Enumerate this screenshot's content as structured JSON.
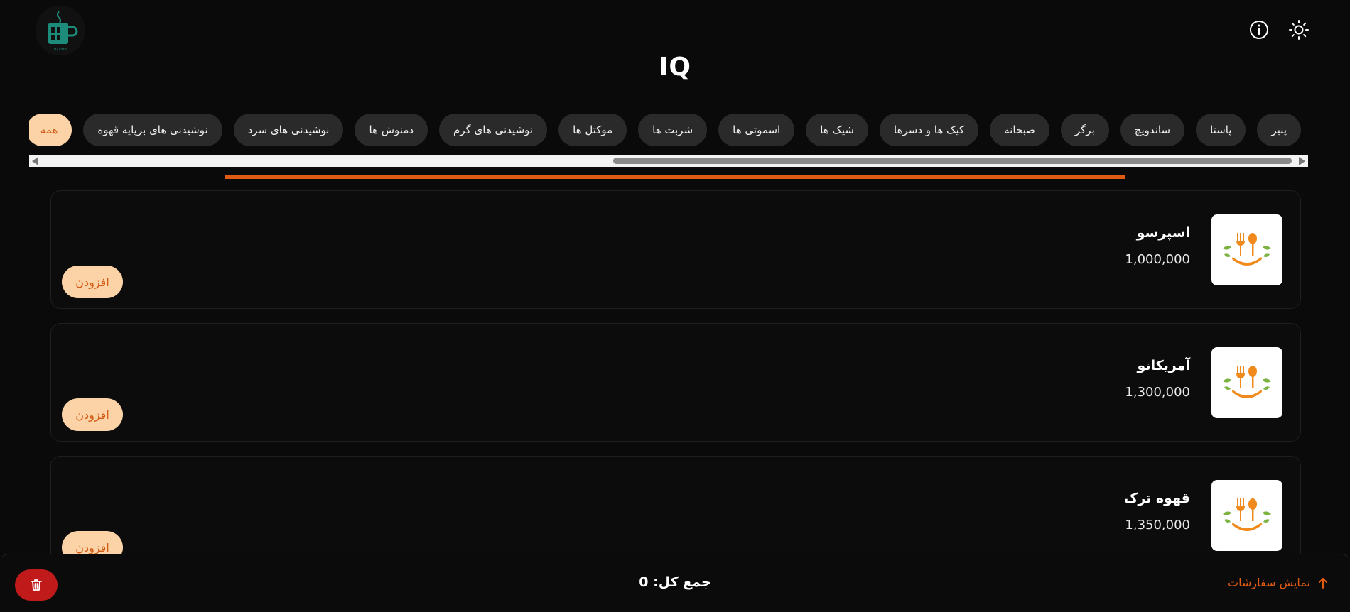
{
  "header": {
    "title": "IQ",
    "logo_text": "IQ cafe"
  },
  "categories": [
    {
      "label": "همه",
      "active": true
    },
    {
      "label": "نوشیدنی های برپایه قهوه",
      "active": false
    },
    {
      "label": "نوشیدنی های سرد",
      "active": false
    },
    {
      "label": "دمنوش ها",
      "active": false
    },
    {
      "label": "نوشیدنی های گرم",
      "active": false
    },
    {
      "label": "موکتل ها",
      "active": false
    },
    {
      "label": "شربت ها",
      "active": false
    },
    {
      "label": "اسموتی ها",
      "active": false
    },
    {
      "label": "شیک ها",
      "active": false
    },
    {
      "label": "کیک ها و دسرها",
      "active": false
    },
    {
      "label": "صبحانه",
      "active": false
    },
    {
      "label": "برگر",
      "active": false
    },
    {
      "label": "ساندویچ",
      "active": false
    },
    {
      "label": "پاستا",
      "active": false
    },
    {
      "label": "پنیر",
      "active": false
    }
  ],
  "items": [
    {
      "name": "اسپرسو",
      "price": "1,000,000",
      "add_label": "افزودن"
    },
    {
      "name": "آمریکانو",
      "price": "1,300,000",
      "add_label": "افزودن"
    },
    {
      "name": "قهوه ترک",
      "price": "1,350,000",
      "add_label": "افزودن"
    }
  ],
  "footer": {
    "total_label": "جمع کل: 0",
    "show_orders_label": "نمایش سفارشات"
  },
  "colors": {
    "accent": "#e25b12",
    "pill_active_bg": "#fcd3a7",
    "danger": "#c01a1a",
    "background": "#0a0a0a"
  }
}
